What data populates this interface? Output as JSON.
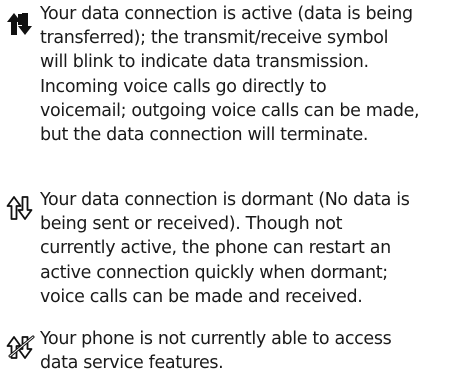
{
  "entries": [
    {
      "icon": "data-active-icon",
      "lines": [
        "Your data connection is active (data is being",
        "transferred); the transmit/receive symbol",
        "will blink to indicate data transmission.",
        "Incoming voice calls go directly to",
        "voicemail; outgoing voice calls can be made,",
        "but the data connection will terminate."
      ]
    },
    {
      "icon": "data-dormant-icon",
      "lines": [
        "Your data connection is dormant (No data is",
        "being sent or received). Though not",
        "currently active, the phone can restart an",
        "active connection quickly when dormant;",
        "voice calls can be made and received."
      ]
    },
    {
      "icon": "data-unavailable-icon",
      "lines": [
        "Your phone is not currently able to access",
        "data service features."
      ]
    }
  ]
}
